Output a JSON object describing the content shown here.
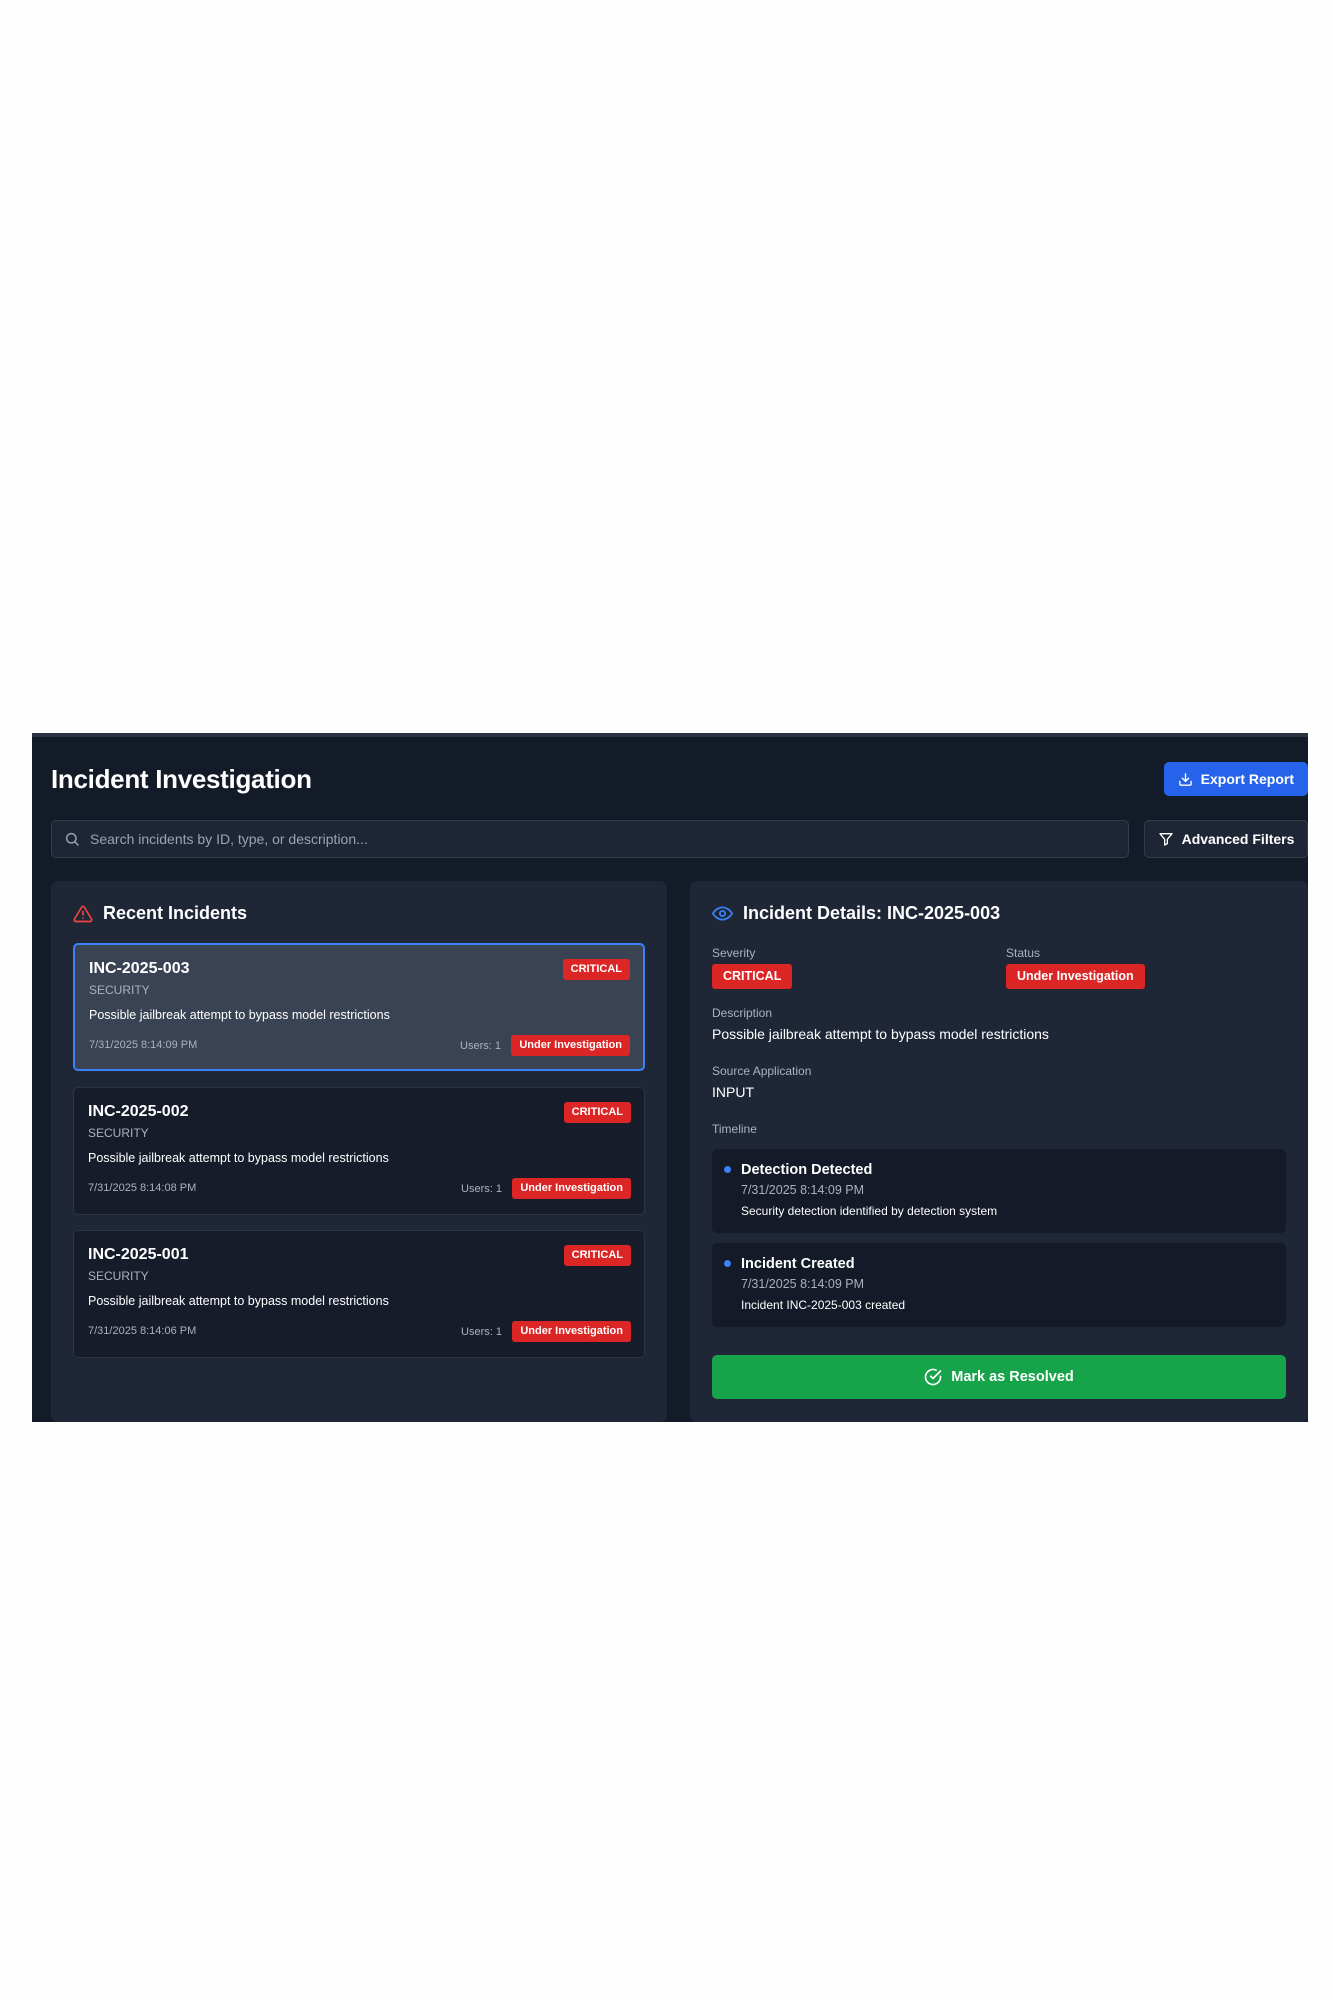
{
  "header": {
    "title": "Incident Investigation",
    "export_label": "Export Report"
  },
  "search": {
    "placeholder": "Search incidents by ID, type, or description...",
    "filters_label": "Advanced Filters"
  },
  "recent": {
    "title": "Recent Incidents",
    "incidents": [
      {
        "id": "INC-2025-003",
        "type": "SECURITY",
        "severity": "CRITICAL",
        "description": "Possible jailbreak attempt to bypass model restrictions",
        "timestamp": "7/31/2025 8:14:09 PM",
        "users": "Users: 1",
        "status": "Under Investigation"
      },
      {
        "id": "INC-2025-002",
        "type": "SECURITY",
        "severity": "CRITICAL",
        "description": "Possible jailbreak attempt to bypass model restrictions",
        "timestamp": "7/31/2025 8:14:08 PM",
        "users": "Users: 1",
        "status": "Under Investigation"
      },
      {
        "id": "INC-2025-001",
        "type": "SECURITY",
        "severity": "CRITICAL",
        "description": "Possible jailbreak attempt to bypass model restrictions",
        "timestamp": "7/31/2025 8:14:06 PM",
        "users": "Users: 1",
        "status": "Under Investigation"
      }
    ]
  },
  "details": {
    "title": "Incident Details: INC-2025-003",
    "severity_label": "Severity",
    "severity": "CRITICAL",
    "status_label": "Status",
    "status": "Under Investigation",
    "description_label": "Description",
    "description": "Possible jailbreak attempt to bypass model restrictions",
    "source_label": "Source Application",
    "source": "INPUT",
    "timeline_label": "Timeline",
    "timeline": [
      {
        "title": "Detection Detected",
        "time": "7/31/2025 8:14:09 PM",
        "text": "Security detection identified by detection system"
      },
      {
        "title": "Incident Created",
        "time": "7/31/2025 8:14:09 PM",
        "text": "Incident INC-2025-003 created"
      }
    ],
    "resolve_label": "Mark as Resolved"
  },
  "colors": {
    "background": "#131a28",
    "panel": "#1f2737",
    "accent": "#2563eb",
    "critical": "#dc2626",
    "success": "#16a34a"
  },
  "icons": [
    "download-icon",
    "search-icon",
    "filter-icon",
    "alert-triangle-icon",
    "eye-icon",
    "check-circle-icon"
  ]
}
